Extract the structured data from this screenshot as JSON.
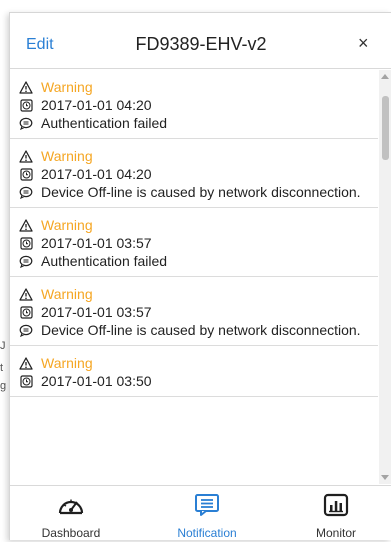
{
  "header": {
    "edit_label": "Edit",
    "title": "FD9389-EHV-v2",
    "close_symbol": "×"
  },
  "notifications": [
    {
      "level": "Warning",
      "time": "2017-01-01 04:20",
      "message": "Authentication failed"
    },
    {
      "level": "Warning",
      "time": "2017-01-01 04:20",
      "message": "Device Off-line is caused by network disconnection."
    },
    {
      "level": "Warning",
      "time": "2017-01-01 03:57",
      "message": "Authentication failed"
    },
    {
      "level": "Warning",
      "time": "2017-01-01 03:57",
      "message": "Device Off-line is caused by network disconnection."
    },
    {
      "level": "Warning",
      "time": "2017-01-01 03:50",
      "message": ""
    }
  ],
  "tabs": [
    {
      "label": "Dashboard",
      "icon": "gauge-icon"
    },
    {
      "label": "Notification",
      "icon": "message-list-icon",
      "active": true
    },
    {
      "label": "Monitor",
      "icon": "bar-chart-icon"
    }
  ],
  "colors": {
    "accent": "#2a7fd4",
    "warning": "#f5a623"
  }
}
